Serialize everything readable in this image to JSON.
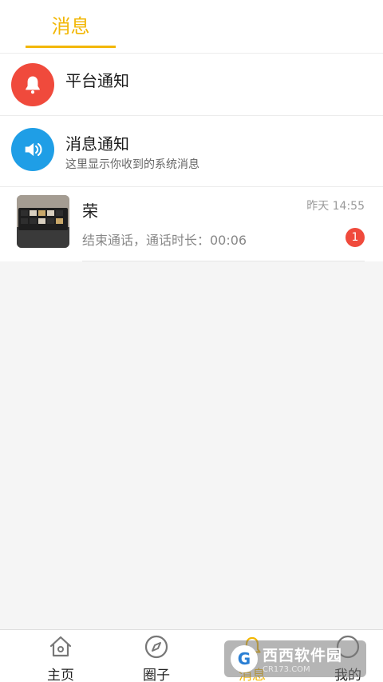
{
  "header": {
    "tab_label": "消息"
  },
  "notifications": [
    {
      "title": "平台通知",
      "subtitle": "",
      "icon": "bell-icon",
      "color": "#f04a3c"
    },
    {
      "title": "消息通知",
      "subtitle": "这里显示你收到的系统消息",
      "icon": "speaker-icon",
      "color": "#1f9ee6"
    }
  ],
  "chat": {
    "name": "荣",
    "preview": "结束通话，通话时长：00:06",
    "time": "昨天 14:55",
    "unread": "1"
  },
  "tabbar": {
    "items": [
      {
        "label": "主页",
        "icon": "home-icon"
      },
      {
        "label": "圈子",
        "icon": "compass-icon"
      },
      {
        "label": "消息",
        "icon": "bell-icon"
      },
      {
        "label": "我的",
        "icon": "profile-icon"
      }
    ],
    "active_index": 2
  },
  "watermark": {
    "main": "西西软件园",
    "sub": "CR173.COM",
    "badge": "G"
  },
  "colors": {
    "accent": "#f2b705",
    "badge_red": "#f04a3c",
    "speaker_blue": "#1f9ee6"
  }
}
